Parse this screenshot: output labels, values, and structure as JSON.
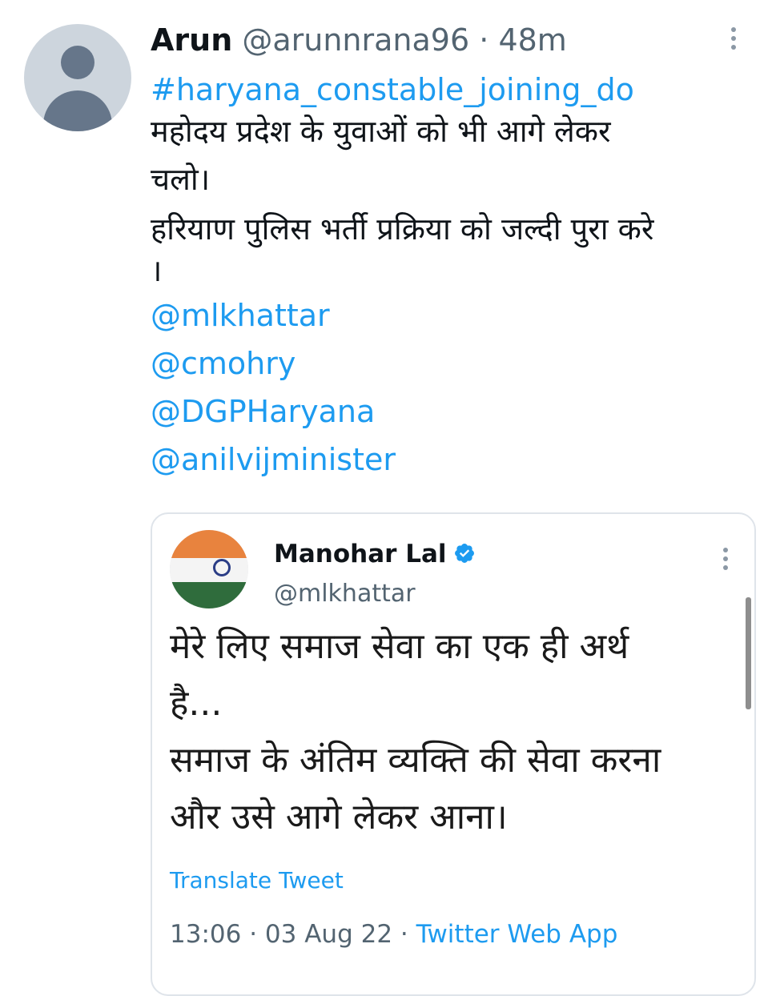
{
  "tweet": {
    "author_name": "Arun",
    "author_handle": "@arunnrana96",
    "separator": "·",
    "time": "48m",
    "lines": [
      {
        "text": "#haryana_constable_joining_do",
        "type": "hashtag"
      },
      {
        "text": "महोदय प्रदेश के युवाओं को भी आगे लेकर",
        "type": "text"
      },
      {
        "text": "चलो।",
        "type": "text"
      },
      {
        "text": "हरियाण पुलिस भर्ती प्रक्रिया को जल्दी पुरा करे",
        "type": "text"
      },
      {
        "text": "।",
        "type": "text"
      },
      {
        "text": "@mlkhattar",
        "type": "mention"
      },
      {
        "text": "@cmohry",
        "type": "mention"
      },
      {
        "text": "@DGPHaryana",
        "type": "mention"
      },
      {
        "text": "@anilvijminister",
        "type": "mention"
      }
    ]
  },
  "quoted": {
    "author_name": "Manohar Lal",
    "author_handle": "@mlkhattar",
    "verified_icon": "verified-badge-icon",
    "lines": [
      "मेरे लिए समाज सेवा का एक ही अर्थ",
      "है...",
      "समाज के अंतिम व्यक्ति की सेवा करना",
      "और उसे आगे लेकर आना।"
    ],
    "translate_label": "Translate Tweet",
    "time": "13:06",
    "separator1": "·",
    "date": "03 Aug 22",
    "separator2": "·",
    "source": "Twitter Web App"
  },
  "colors": {
    "link": "#1d9bf0",
    "secondary_text": "#536471",
    "avatar_bg": "#cdd5dd",
    "avatar_fg": "#66768a"
  }
}
